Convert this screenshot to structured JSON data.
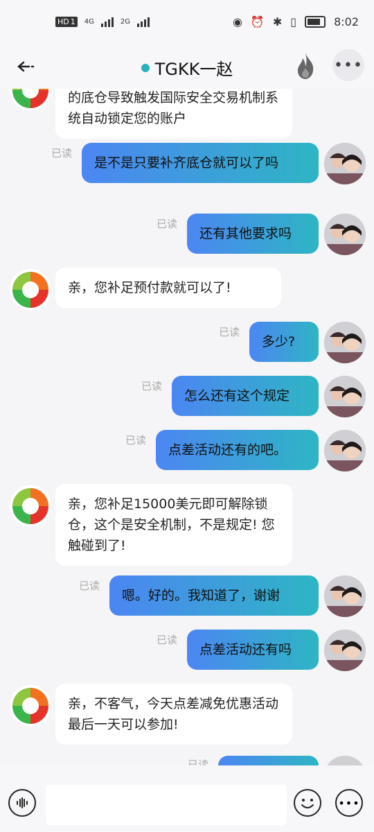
{
  "status_bar": {
    "hd": "HD",
    "sim": "1",
    "net1": "4G",
    "net2": "2G",
    "time": "8:02"
  },
  "header": {
    "title": "TGKK一赵",
    "status_color": "#27b0c0",
    "back_icon": "arrow-left-icon",
    "flame_icon": "flame-icon",
    "more_icon": "more-icon"
  },
  "read_label": "已读",
  "messages": [
    {
      "side": "in",
      "text": "的底仓导致触发国际安全交易机制系统自动锁定您的账户"
    },
    {
      "side": "out",
      "text": "是不是只要补齐底仓就可以了吗",
      "read": "已读"
    },
    {
      "side": "out",
      "text": "还有其他要求吗",
      "read": "已读"
    },
    {
      "side": "in",
      "text": "亲，您补足预付款就可以了!"
    },
    {
      "side": "out",
      "text": "多少?",
      "read": "已读"
    },
    {
      "side": "out",
      "text": "怎么还有这个规定",
      "read": "已读"
    },
    {
      "side": "out",
      "text": "点差活动还有的吧。",
      "read": "已读"
    },
    {
      "side": "in",
      "text": "亲，您补足15000美元即可解除锁仓，这个是安全机制，不是规定! 您触碰到了!"
    },
    {
      "side": "out",
      "text": "嗯。好的。我知道了，谢谢",
      "read": "已读"
    },
    {
      "side": "out",
      "text": "点差活动还有吗",
      "read": "已读"
    },
    {
      "side": "in",
      "text": "亲，不客气，今天点差减免优惠活动最后一天可以参加!"
    },
    {
      "side": "out",
      "text": "",
      "read": "已读"
    }
  ],
  "input": {
    "placeholder": "",
    "value": ""
  },
  "colors": {
    "bubble_out_start": "#4c86f2",
    "bubble_out_end": "#2eb5c4",
    "bubble_in": "#ffffff",
    "background": "#f5f5f7"
  }
}
